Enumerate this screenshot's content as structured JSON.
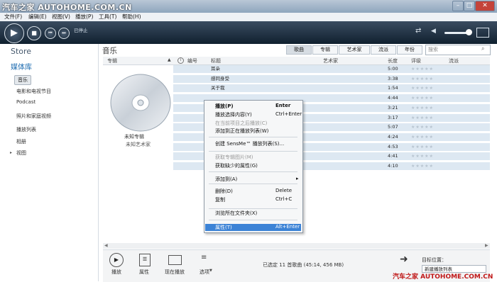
{
  "watermark": "汽车之家 AUTOHOME.COM.CN",
  "watermark_bottom": "汽车之家 AUTOHOME.COM.CN",
  "menu": [
    "文件(F)",
    "编辑(E)",
    "视图(V)",
    "播放(P)",
    "工具(T)",
    "帮助(H)"
  ],
  "player": {
    "status": "已停止"
  },
  "sidebar": {
    "store": "Store",
    "library": "媒体库",
    "selected": "音乐",
    "items": [
      "电影和电视节目",
      "Podcast",
      "照片和家庭视频",
      "播放列表",
      "相册",
      "视图"
    ]
  },
  "header": {
    "title": "音乐",
    "tabs": [
      "歌曲",
      "专辑",
      "艺术家",
      "流派",
      "年份"
    ],
    "search_placeholder": "搜索"
  },
  "columns": [
    "专辑",
    "编号",
    "标题",
    "艺术家",
    "长度",
    "评级",
    "流派"
  ],
  "album": {
    "name": "未知专辑",
    "artist": "未知艺术家"
  },
  "songs": [
    {
      "title": "耳朵",
      "length": "5:00"
    },
    {
      "title": "感同身受",
      "length": "3:38"
    },
    {
      "title": "关于我",
      "length": "1:54"
    },
    {
      "title": "",
      "length": "4:44"
    },
    {
      "title": "",
      "length": "3:21"
    },
    {
      "title": "",
      "length": "3:17"
    },
    {
      "title": "",
      "length": "5:07"
    },
    {
      "title": "",
      "length": "4:24"
    },
    {
      "title": "",
      "length": "4:53"
    },
    {
      "title": "",
      "length": "4:41"
    },
    {
      "title": "",
      "length": "4:10"
    }
  ],
  "context_menu": [
    {
      "label": "播放(P)",
      "shortcut": "Enter",
      "bold": true
    },
    {
      "label": "播放选择内容(Y)",
      "shortcut": "Ctrl+Enter"
    },
    {
      "label": "在当前项目之后播放(C)",
      "shortcut": "",
      "disabled": true
    },
    {
      "label": "添加到正在播放列表(W)",
      "shortcut": ""
    },
    {
      "label": "创建 SensMe™ 播放列表(S)...",
      "shortcut": ""
    },
    {
      "label": "获取专辑图片(M)",
      "shortcut": "",
      "disabled": true
    },
    {
      "label": "获取缺少的属性(G)",
      "shortcut": ""
    },
    {
      "label": "添加到(A)",
      "shortcut": "▸"
    },
    {
      "label": "删除(D)",
      "shortcut": "Delete"
    },
    {
      "label": "复制",
      "shortcut": "Ctrl+C"
    },
    {
      "label": "浏览所在文件夹(X)",
      "shortcut": ""
    },
    {
      "label": "属性(T)",
      "shortcut": "Alt+Enter",
      "highlighted": true
    }
  ],
  "toolbar": {
    "play": "播放",
    "properties": "属性",
    "now_playing": "现在播放",
    "options": "选项"
  },
  "status_bar": "已选定 11 首歌曲 (45:14, 456 MB)",
  "target": {
    "label": "目标位置：",
    "value": "新建播放列表"
  },
  "colors": {
    "accent": "#3c83d6",
    "row": "#dde8f2",
    "player": "#1b2b3b"
  }
}
